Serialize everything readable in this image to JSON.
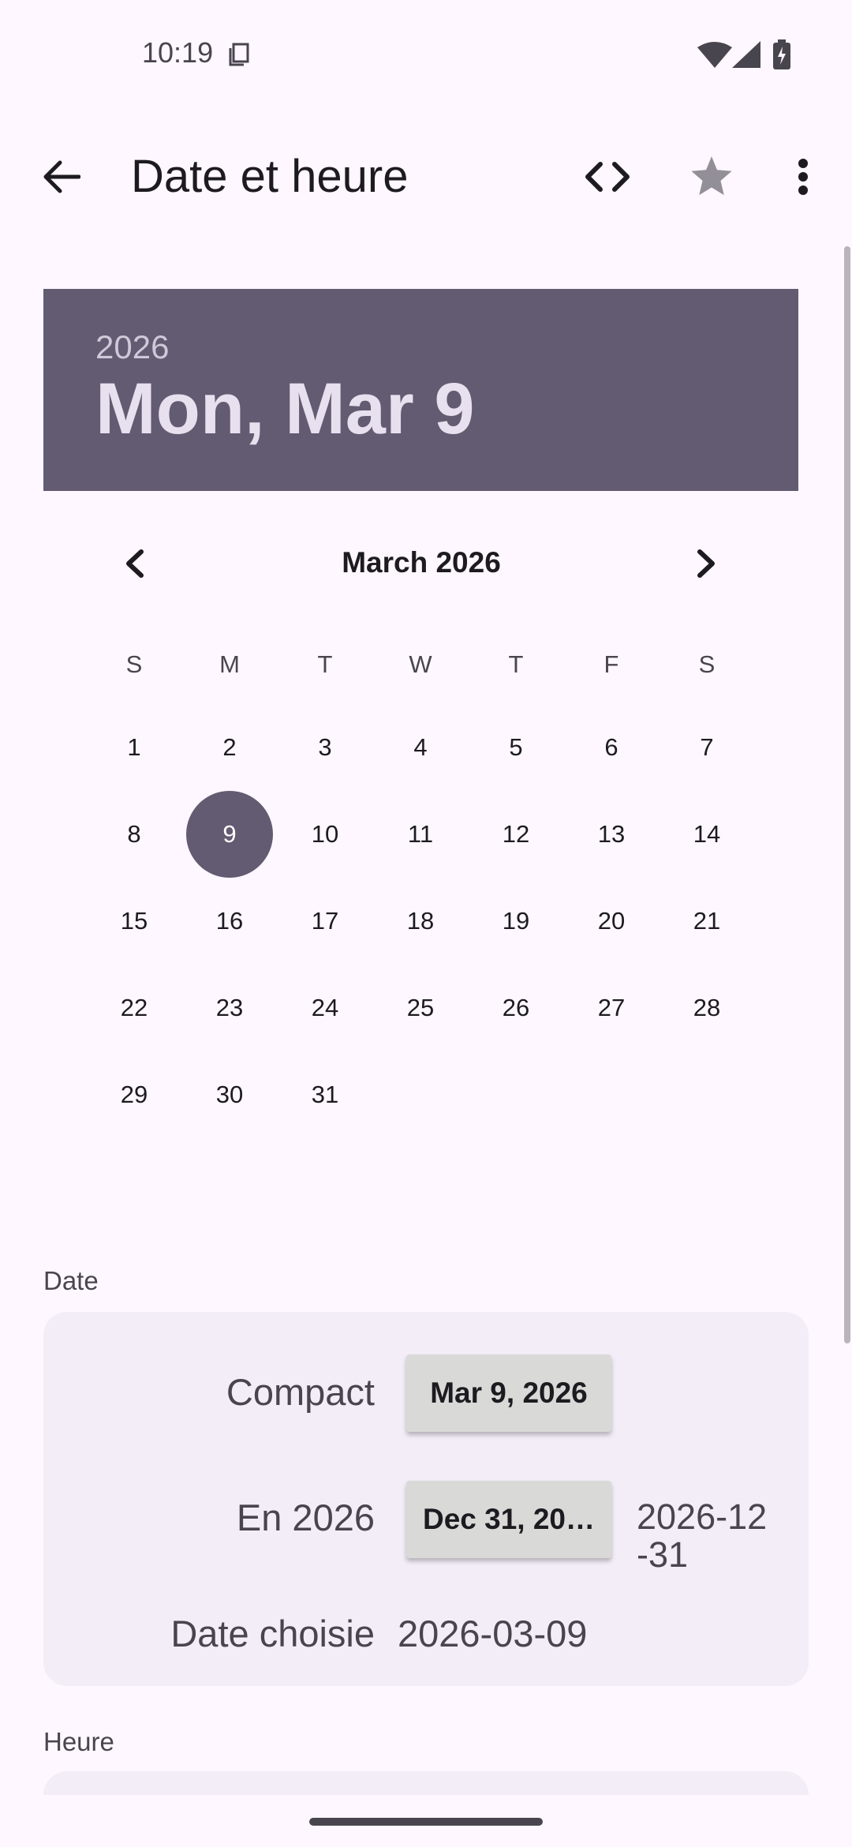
{
  "status_bar": {
    "time": "10:19"
  },
  "app_bar": {
    "title": "Date et heure"
  },
  "date_picker": {
    "year": "2026",
    "selected_date": "Mon, Mar 9",
    "month_label": "March 2026",
    "weekdays": [
      "S",
      "M",
      "T",
      "W",
      "T",
      "F",
      "S"
    ],
    "days": [
      "1",
      "2",
      "3",
      "4",
      "5",
      "6",
      "7",
      "8",
      "9",
      "10",
      "11",
      "12",
      "13",
      "14",
      "15",
      "16",
      "17",
      "18",
      "19",
      "20",
      "21",
      "22",
      "23",
      "24",
      "25",
      "26",
      "27",
      "28",
      "29",
      "30",
      "31"
    ],
    "selected_day": "9"
  },
  "date_section": {
    "label": "Date",
    "compact_label": "Compact",
    "compact_value": "Mar 9, 2026",
    "year_label": "En 2026",
    "year_value": "Dec 31, 20…",
    "year_value_iso_line1": "2026-12",
    "year_value_iso_line2": "-31",
    "chosen_label": "Date choisie",
    "chosen_value": "2026-03-09"
  },
  "time_section": {
    "label": "Heure"
  },
  "colors": {
    "accent": "#625B71",
    "background": "#FEF7FF",
    "card": "#F3EDF7"
  }
}
